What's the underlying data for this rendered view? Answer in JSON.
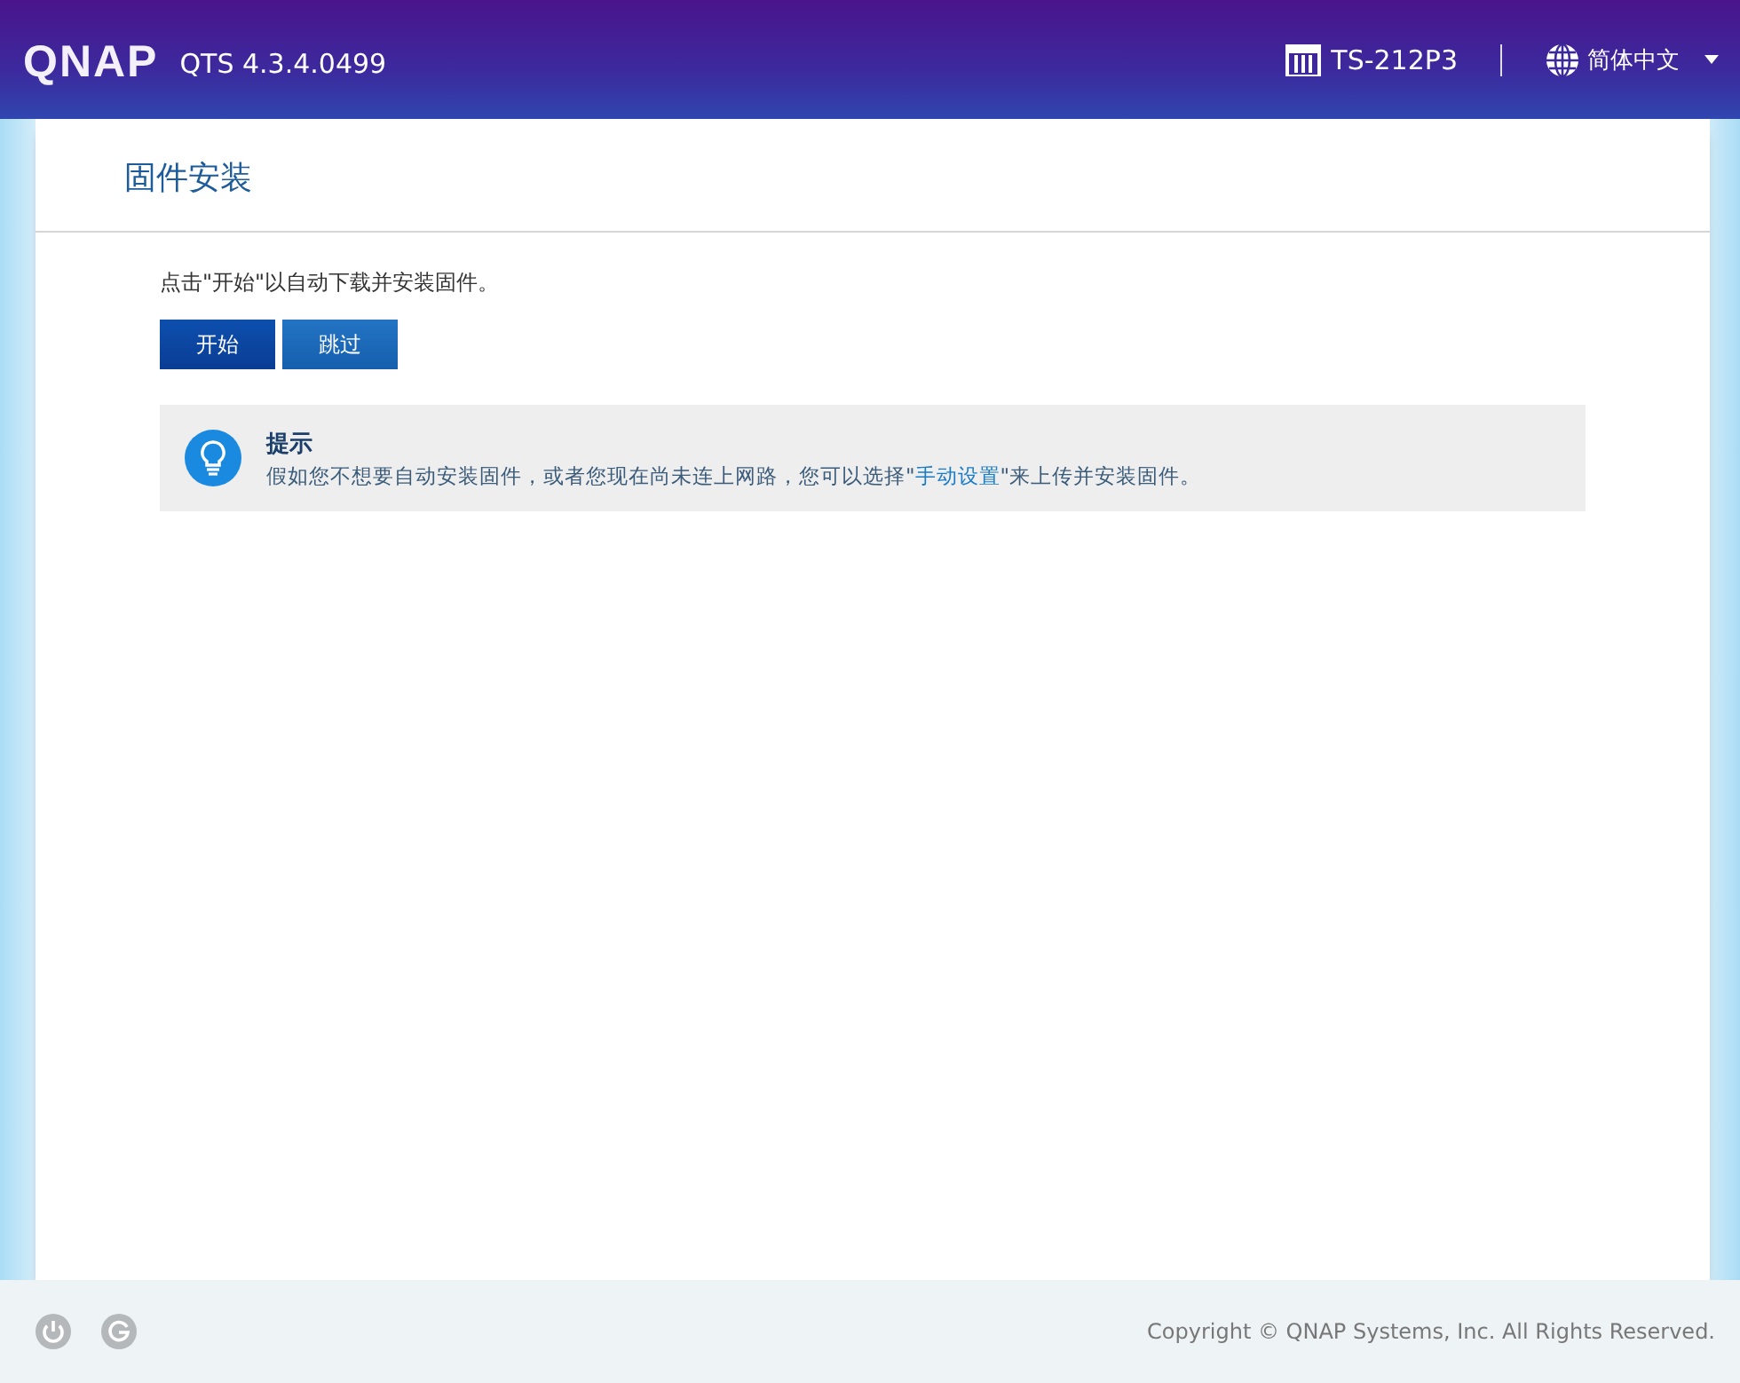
{
  "header": {
    "logo": "QNAP",
    "version": "QTS 4.3.4.0499",
    "device": "TS-212P3",
    "language": "简体中文"
  },
  "page": {
    "title": "固件安装",
    "instruction": "点击\"开始\"以自动下载并安装固件。",
    "buttons": [
      {
        "label": "开始",
        "kind": "primary"
      },
      {
        "label": "跳过",
        "kind": "secondary"
      }
    ],
    "hint": {
      "title": "提示",
      "text_before": "假如您不想要自动安装固件，或者您现在尚未连上网路，您可以选择\"",
      "link": "手动设置",
      "text_after": "\"来上传并安装固件。"
    }
  },
  "footer": {
    "copyright": "Copyright © QNAP Systems, Inc. All Rights Reserved."
  }
}
